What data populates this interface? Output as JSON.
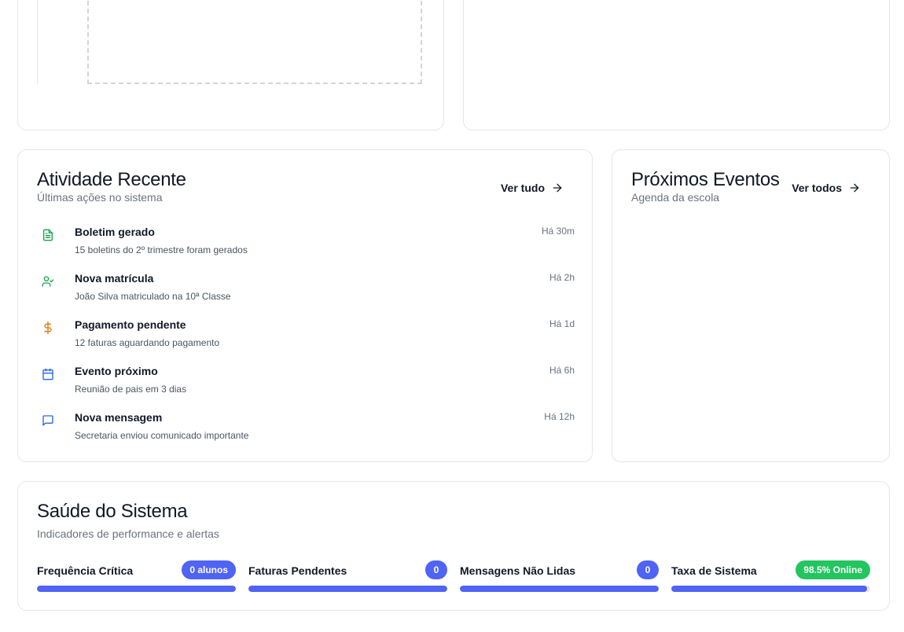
{
  "activity": {
    "title": "Atividade Recente",
    "subtitle": "Últimas ações no sistema",
    "link_label": "Ver tudo",
    "items": [
      {
        "icon": "file-text-icon",
        "color": "#16a34a",
        "title": "Boletim gerado",
        "desc": "15 boletins do 2º trimestre foram gerados",
        "time": "Há 30m"
      },
      {
        "icon": "user-check-icon",
        "color": "#16a34a",
        "title": "Nova matrícula",
        "desc": "João Silva matriculado na 10ª Classe",
        "time": "Há 2h"
      },
      {
        "icon": "dollar-icon",
        "color": "#d97706",
        "title": "Pagamento pendente",
        "desc": "12 faturas aguardando pagamento",
        "time": "Há 1d"
      },
      {
        "icon": "calendar-icon",
        "color": "#2563eb",
        "title": "Evento próximo",
        "desc": "Reunião de pais em 3 dias",
        "time": "Há 6h"
      },
      {
        "icon": "message-icon",
        "color": "#2563eb",
        "title": "Nova mensagem",
        "desc": "Secretaria enviou comunicado importante",
        "time": "Há 12h"
      }
    ]
  },
  "events": {
    "title": "Próximos Eventos",
    "subtitle": "Agenda da escola",
    "link_label": "Ver todos"
  },
  "health": {
    "title": "Saúde do Sistema",
    "subtitle": "Indicadores de performance e alertas",
    "metrics": [
      {
        "label": "Frequência Crítica",
        "badge": "0 alunos",
        "badge_color": "#4f63f5",
        "bar_color": "#4f63f5",
        "progress": 1.0
      },
      {
        "label": "Faturas Pendentes",
        "badge": "0",
        "badge_color": "#4f63f5",
        "bar_color": "#4f63f5",
        "progress": 1.0
      },
      {
        "label": "Mensagens Não Lidas",
        "badge": "0",
        "badge_color": "#4f63f5",
        "bar_color": "#4f63f5",
        "progress": 1.0
      },
      {
        "label": "Taxa de Sistema",
        "badge": "98.5% Online",
        "badge_color": "#22c55e",
        "bar_color": "#4f63f5",
        "progress": 0.985
      }
    ]
  }
}
